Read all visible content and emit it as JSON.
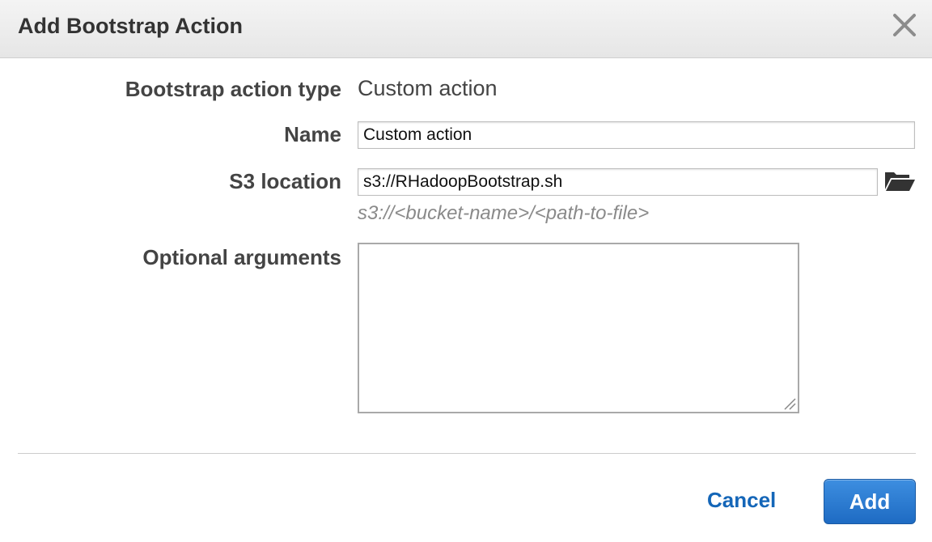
{
  "dialog": {
    "title": "Add Bootstrap Action",
    "close_icon": "close-icon"
  },
  "form": {
    "type_label": "Bootstrap action type",
    "type_value": "Custom action",
    "name_label": "Name",
    "name_value": "Custom action",
    "s3_label": "S3 location",
    "s3_value": "s3://RHadoopBootstrap.sh",
    "s3_hint": "s3://<bucket-name>/<path-to-file>",
    "s3_browse_icon": "folder-open-icon",
    "args_label": "Optional arguments",
    "args_value": ""
  },
  "footer": {
    "cancel_label": "Cancel",
    "add_label": "Add"
  },
  "colors": {
    "link": "#1466b8",
    "primary_button": "#2a7bd2",
    "header_bg": "#ececec"
  }
}
